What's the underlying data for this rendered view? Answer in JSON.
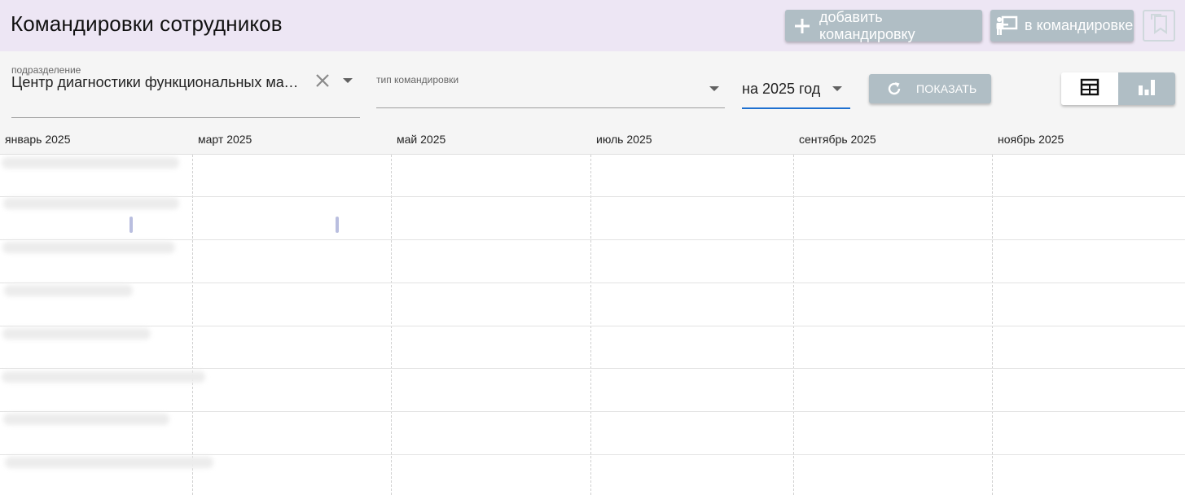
{
  "header": {
    "title": "Командировки сотрудников",
    "add_button_label": "добавить командировку",
    "on_trip_button_label": "в командировке",
    "bookmark_icon": "bookmark-icon"
  },
  "filters": {
    "department": {
      "label": "подразделение",
      "value": "Центр диагностики функциональных материалов"
    },
    "trip_type": {
      "label": "тип командировки",
      "value": ""
    },
    "year": {
      "value": "на 2025 год"
    },
    "show_button_label": "ПОКАЗАТЬ"
  },
  "view_toggle": {
    "active": "table",
    "options": [
      "table",
      "chart"
    ]
  },
  "months": [
    "январь 2025",
    "март 2025",
    "май 2025",
    "июль 2025",
    "сентябрь 2025",
    "ноябрь 2025"
  ],
  "colors": {
    "header_bg": "#ede6f4",
    "button_bg": "#b0bec5",
    "accent": "#1e70d0",
    "trip_marker": "#b9bedf"
  }
}
